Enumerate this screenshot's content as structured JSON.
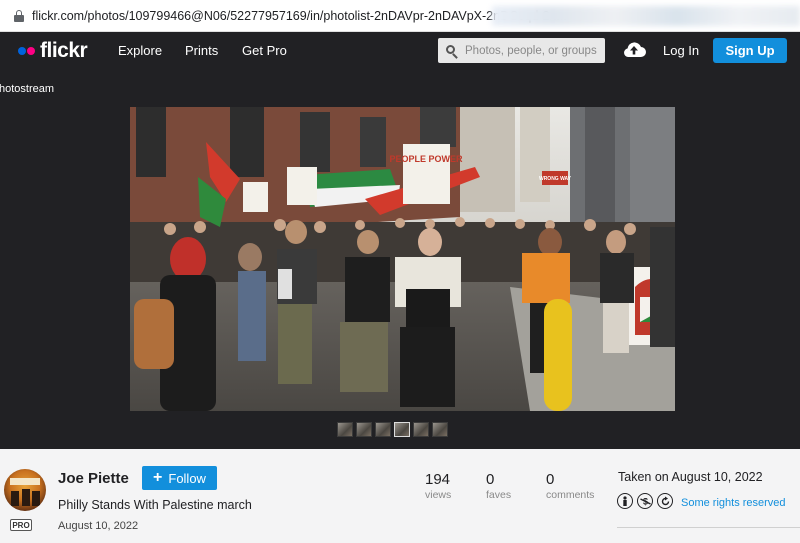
{
  "browser": {
    "url": "flickr.com/photos/109799466@N06/52277957169/in/photolist-2nDAVpr-2nDAVpX-2nDCcqd-2n..."
  },
  "nav": {
    "logo": "flickr",
    "links": [
      "Explore",
      "Prints",
      "Get Pro"
    ],
    "search_placeholder": "Photos, people, or groups",
    "login": "Log In",
    "signup": "Sign Up"
  },
  "viewer": {
    "back_link": "hotostream",
    "photo_signs": [
      "PEOPLE POWER",
      "WRONG WAY"
    ]
  },
  "info": {
    "author": "Joe Piette",
    "follow_label": "Follow",
    "pro_badge": "PRO",
    "title": "Philly Stands With Palestine march",
    "date": "August 10, 2022",
    "stats": [
      {
        "value": "194",
        "label": "views"
      },
      {
        "value": "0",
        "label": "faves"
      },
      {
        "value": "0",
        "label": "comments"
      }
    ],
    "taken": "Taken on August 10, 2022",
    "license_icons": [
      "cc-by-icon",
      "cc-nc-icon",
      "cc-sa-icon"
    ],
    "rights": "Some rights reserved"
  },
  "colors": {
    "nav_bg": "#212124",
    "accent_blue": "#128fdc",
    "logo_blue": "#0063dc",
    "logo_pink": "#ff0084"
  }
}
